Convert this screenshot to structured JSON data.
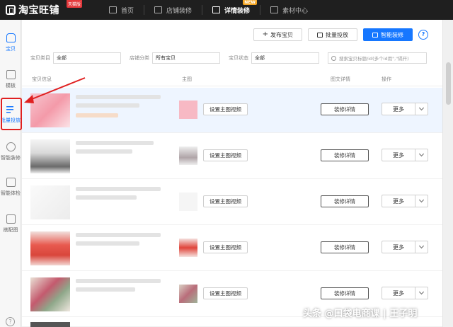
{
  "app": {
    "logo_text": "淘宝旺铺",
    "logo_badge": "天猫版"
  },
  "nav": [
    {
      "label": "首页",
      "icon": "home-icon"
    },
    {
      "label": "店铺装修",
      "icon": "monitor-icon"
    },
    {
      "label": "详情装修",
      "icon": "doc-icon",
      "active": true,
      "badge": "NEW"
    },
    {
      "label": "素材中心",
      "icon": "image-icon"
    }
  ],
  "sidebar": [
    {
      "label": "宝贝",
      "icon": "bag-icon"
    },
    {
      "label": "模板",
      "icon": "folder-icon"
    },
    {
      "label": "批量投放",
      "icon": "list-edit-icon",
      "active": true
    },
    {
      "label": "智能装修",
      "icon": "bulb-icon"
    },
    {
      "label": "智能体检",
      "icon": "shield-check-icon"
    },
    {
      "label": "搭配图",
      "icon": "picture-icon"
    }
  ],
  "toolbar": {
    "publish_label": "发布宝贝",
    "batch_label": "批量投放",
    "smart_label": "智能装修",
    "help": "?"
  },
  "filters": {
    "category_label": "宝贝类目",
    "category_value": "全部",
    "shop_cat_label": "店铺分类",
    "shop_cat_value": "所有宝贝",
    "status_label": "宝贝状态",
    "status_value": "全部",
    "search_placeholder": "搜索宝贝标题/id(多个id用\",\"隔开)"
  },
  "table": {
    "headers": {
      "info": "宝贝信息",
      "main_image": "主图",
      "detail": "图文详情",
      "action": "操作"
    },
    "rows": [
      {
        "video_label": "设置主图视频",
        "decor_label": "装修详情",
        "more_label": "更多"
      },
      {
        "video_label": "设置主图视频",
        "decor_label": "装修详情",
        "more_label": "更多"
      },
      {
        "video_label": "设置主图视频",
        "decor_label": "装修详情",
        "more_label": "更多"
      },
      {
        "video_label": "设置主图视频",
        "decor_label": "装修详情",
        "more_label": "更多"
      },
      {
        "video_label": "设置主图视频",
        "decor_label": "装修详情",
        "more_label": "更多"
      }
    ]
  },
  "watermark": "头条 @口袋电商课 | 王子明",
  "colors": {
    "accent": "#1677ff",
    "topbar": "#1f1f1f",
    "highlight": "#e02020"
  }
}
